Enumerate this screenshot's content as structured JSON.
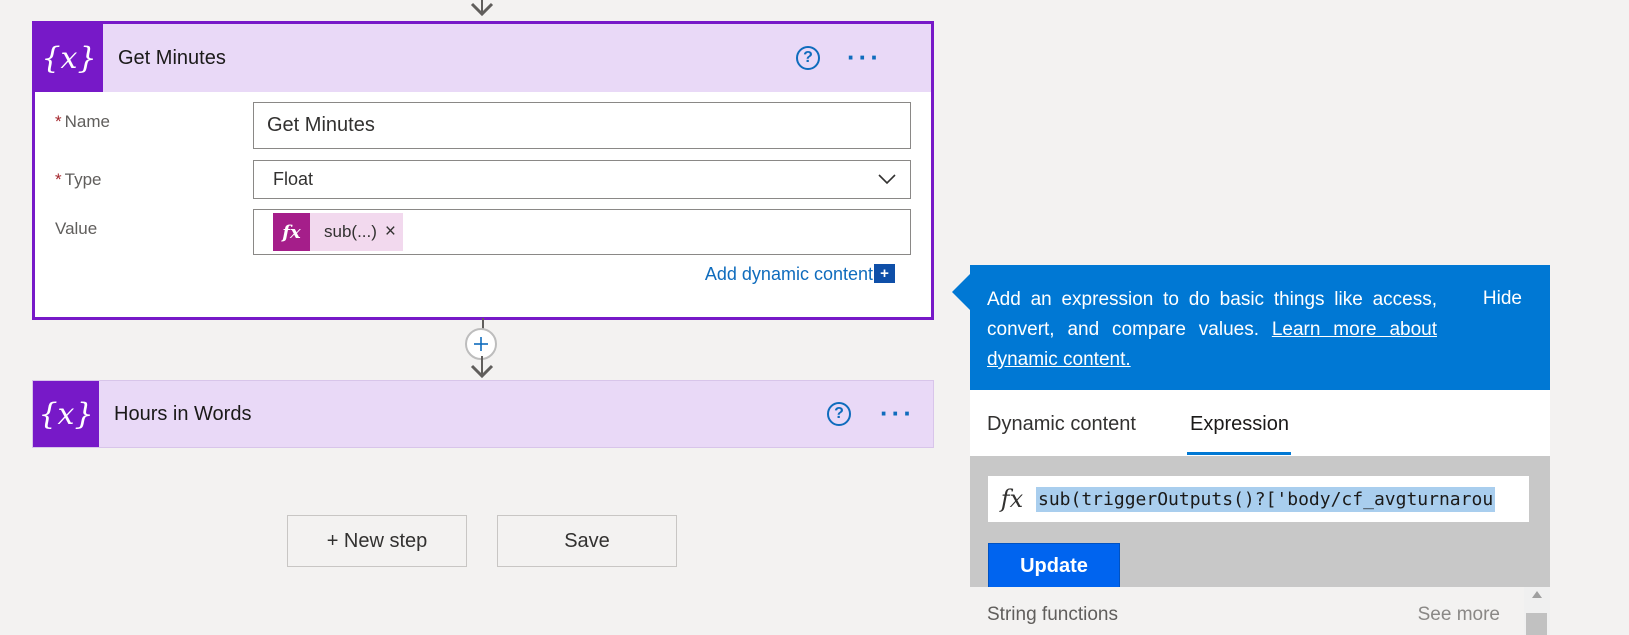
{
  "card1": {
    "title": "Get Minutes",
    "icon": "variable-icon",
    "name_label": "Name",
    "name_value": "Get Minutes",
    "type_label": "Type",
    "type_value": "Float",
    "value_label": "Value",
    "token_label": "sub(...)",
    "token_close": "×",
    "add_dynamic_label": "Add dynamic content",
    "required_mark": "*"
  },
  "card2": {
    "title": "Hours in Words",
    "icon": "variable-icon"
  },
  "icons": {
    "var_glyph": "{x}",
    "fx_glyph": "fx",
    "help_glyph": "?",
    "more_glyph": "···",
    "plus_glyph": "+"
  },
  "buttons": {
    "new_step": "+ New step",
    "save": "Save"
  },
  "panel": {
    "info_text": "Add an expression to do basic things like access, convert, and compare values.",
    "info_link": "Learn more about dynamic content.",
    "hide": "Hide",
    "tab_dynamic": "Dynamic content",
    "tab_expression": "Expression",
    "expression_value": "sub(triggerOutputs()?['body/cf_avgturnarou",
    "update": "Update",
    "section_label": "String functions",
    "see_more": "See more"
  },
  "colors": {
    "accent_purple": "#7719c8",
    "header_lavender": "#e9d9f7",
    "token_magenta": "#a51e8a",
    "info_blue": "#0078d4",
    "update_blue": "#0064ef",
    "link_blue": "#0f6cbd"
  }
}
